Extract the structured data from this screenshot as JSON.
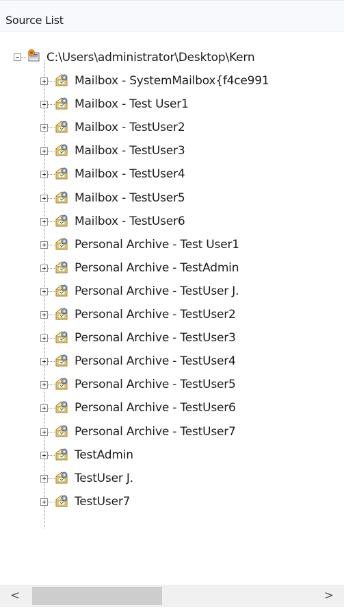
{
  "header": {
    "title": "Source List"
  },
  "tree": {
    "root": {
      "label": "C:\\Users\\administrator\\Desktop\\Kern",
      "expanded": true,
      "icon": "pst-folder-icon"
    },
    "children": [
      {
        "label": "Mailbox - SystemMailbox{f4ce991",
        "icon": "mailbox-icon"
      },
      {
        "label": "Mailbox - Test User1",
        "icon": "mailbox-icon"
      },
      {
        "label": "Mailbox - TestUser2",
        "icon": "mailbox-icon"
      },
      {
        "label": "Mailbox - TestUser3",
        "icon": "mailbox-icon"
      },
      {
        "label": "Mailbox - TestUser4",
        "icon": "mailbox-icon"
      },
      {
        "label": "Mailbox - TestUser5",
        "icon": "mailbox-icon"
      },
      {
        "label": "Mailbox - TestUser6",
        "icon": "mailbox-icon"
      },
      {
        "label": "Personal Archive - Test User1",
        "icon": "mailbox-icon"
      },
      {
        "label": "Personal Archive - TestAdmin",
        "icon": "mailbox-icon"
      },
      {
        "label": "Personal Archive - TestUser J.",
        "icon": "mailbox-icon"
      },
      {
        "label": "Personal Archive - TestUser2",
        "icon": "mailbox-icon"
      },
      {
        "label": "Personal Archive - TestUser3",
        "icon": "mailbox-icon"
      },
      {
        "label": "Personal Archive - TestUser4",
        "icon": "mailbox-icon"
      },
      {
        "label": "Personal Archive - TestUser5",
        "icon": "mailbox-icon"
      },
      {
        "label": "Personal Archive - TestUser6",
        "icon": "mailbox-icon"
      },
      {
        "label": "Personal Archive - TestUser7",
        "icon": "mailbox-icon"
      },
      {
        "label": "TestAdmin",
        "icon": "mailbox-icon"
      },
      {
        "label": "TestUser J.",
        "icon": "mailbox-icon"
      },
      {
        "label": "TestUser7",
        "icon": "mailbox-icon"
      }
    ]
  },
  "scrollbar": {
    "left_arrow": "<",
    "right_arrow": ">"
  }
}
